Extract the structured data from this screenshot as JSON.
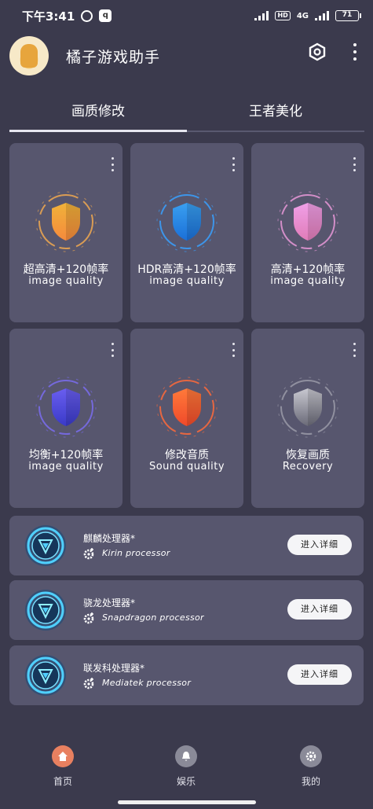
{
  "status_bar": {
    "time": "下午3:41",
    "qq_icon": "q",
    "network": "4G",
    "hd": "HD",
    "battery": "71"
  },
  "header": {
    "title": "橘子游戏助手",
    "hex_icon": "hexagon-settings",
    "more_icon": "more-vertical"
  },
  "tabs": [
    {
      "label": "画质修改",
      "active": true
    },
    {
      "label": "王者美化",
      "active": false
    }
  ],
  "cards": [
    {
      "cn": "超高清+120帧率",
      "en": "image quality",
      "color": "#f0b23a",
      "color2": "#f58a3c",
      "ring": "#f0a850"
    },
    {
      "cn": "HDR高清+120帧率",
      "en": "image quality",
      "color": "#3aa0f0",
      "color2": "#1a6fd8",
      "ring": "#38a0ff"
    },
    {
      "cn": "高清+120帧率",
      "en": "image quality",
      "color": "#f0a0e8",
      "color2": "#e07cb8",
      "ring": "#e898d8"
    },
    {
      "cn": "均衡+120帧率",
      "en": "image quality",
      "color": "#6a5ef0",
      "color2": "#3a3ac8",
      "ring": "#7a6cf0"
    },
    {
      "cn": "修改音质",
      "en": "Sound quality",
      "color": "#ff7a3a",
      "color2": "#f04a2a",
      "ring": "#ff6a3a"
    },
    {
      "cn": "恢复画质",
      "en": "Recovery",
      "color": "#c8c8d0",
      "color2": "#6a6a78",
      "ring": "#9a9aa8"
    }
  ],
  "processors": [
    {
      "title": "麒麟处理器*",
      "subtitle": "Kirin processor",
      "button": "进入详细"
    },
    {
      "title": "骁龙处理器*",
      "subtitle": "Snapdragon processor",
      "button": "进入详细"
    },
    {
      "title": "联发科处理器*",
      "subtitle": "Mediatek processor",
      "button": "进入详细"
    }
  ],
  "bottom_nav": [
    {
      "label": "首页",
      "icon": "home-icon",
      "color": "#e88060"
    },
    {
      "label": "娱乐",
      "icon": "bell-icon",
      "color": "#8a8a98"
    },
    {
      "label": "我的",
      "icon": "gear-icon",
      "color": "#8a8a98"
    }
  ]
}
